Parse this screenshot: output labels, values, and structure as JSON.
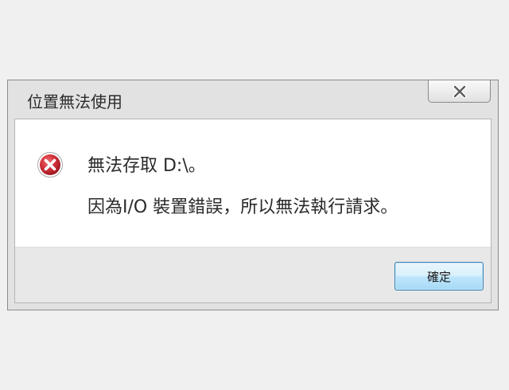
{
  "dialog": {
    "title": "位置無法使用",
    "close_icon": "close-icon",
    "error_icon": "error-icon",
    "message_line1": "無法存取 D:\\。",
    "message_line2": "因為I/O 裝置錯誤，所以無法執行請求。",
    "ok_label": "確定"
  },
  "colors": {
    "error_red": "#c8262e",
    "button_border": "#3c7fb1"
  }
}
